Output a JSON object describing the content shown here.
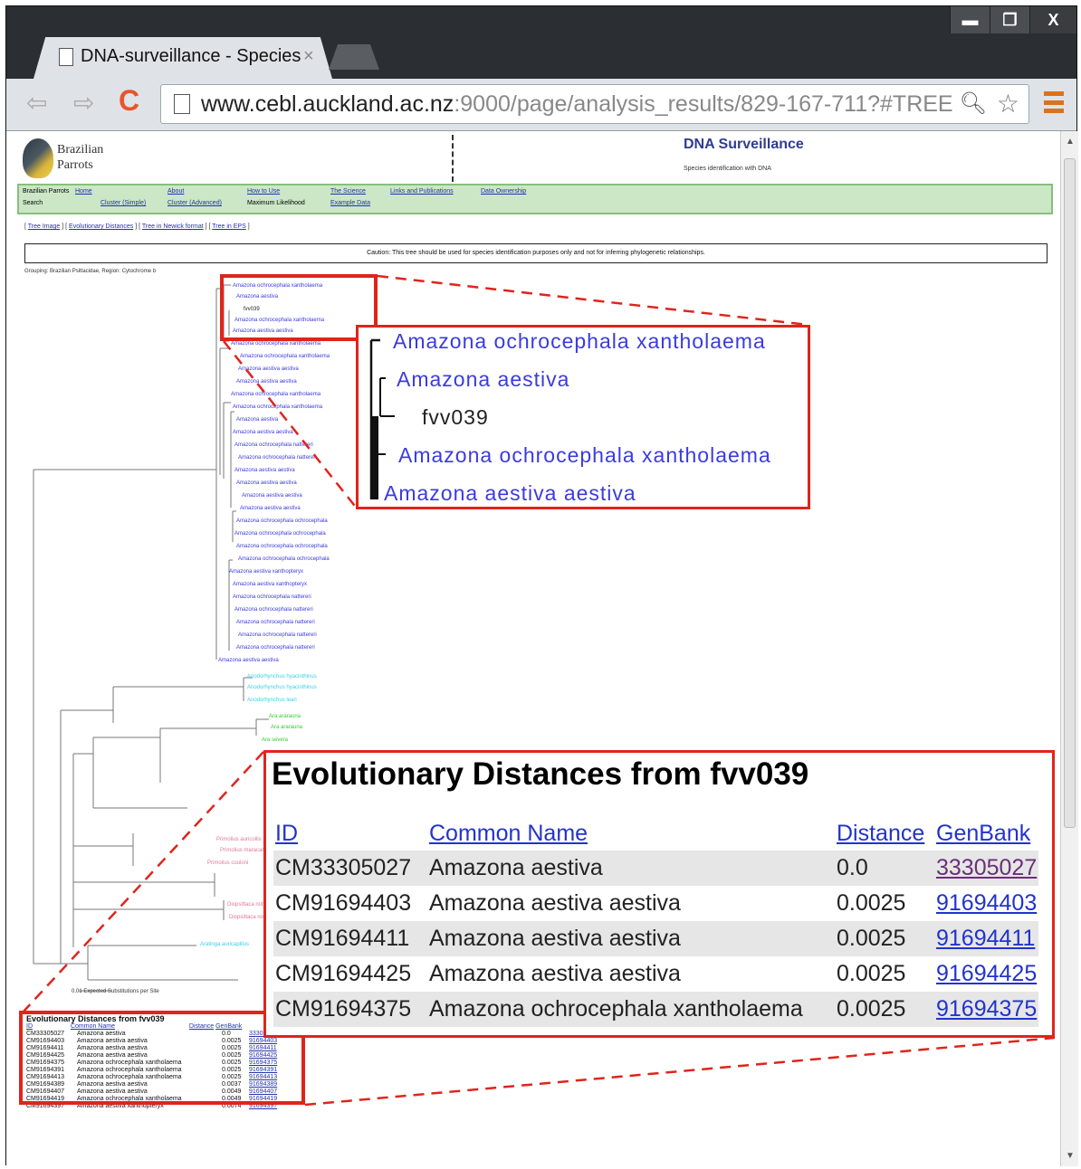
{
  "browser": {
    "tab_title": "DNA-surveillance - Species",
    "tab_close": "×",
    "url_host": "www.cebl.auckland.ac.nz",
    "url_rest": ":9000/page/analysis_results/829-167-711?#TREE",
    "window_buttons": [
      "▬",
      "❐",
      "X"
    ]
  },
  "header": {
    "logo_line1": "Brazilian",
    "logo_line2": "Parrots",
    "title": "DNA Surveillance",
    "subtitle": "Species identification with DNA"
  },
  "navbar": {
    "row1": [
      "Brazilian Parrots",
      "Home",
      "About",
      "How to Use",
      "The Science",
      "Links and Publications",
      "Data Ownership"
    ],
    "row2": [
      "Search",
      "Cluster (Simple)",
      "Cluster (Advanced)",
      "Maximum Likelihood",
      "Example Data"
    ]
  },
  "tool_links": [
    "Tree Image",
    "Evolutionary Distances",
    "Tree in Newick format",
    "Tree in EPS"
  ],
  "caution": "Caution: This tree should be used for species identification purposes only and not for inferring phylogenetic relationships.",
  "grouping": "Grouping: Brazilian Psittacidae, Region: Cytochrome b",
  "scale_label": "0.01 Expected Substitutions per Site",
  "tree_leaves": [
    "Amazona ochrocephala xantholaema",
    "Amazona aestiva",
    "fvv039",
    "Amazona ochrocephala xantholaema",
    "Amazona aestiva aestiva",
    "Amazona ochrocephala xantholaema",
    "Amazona ochrocephala xantholaema",
    "Amazona aestiva aestiva",
    "Amazona aestiva aestiva",
    "Amazona ochrocephala xantholaema",
    "Amazona ochrocephala xantholaema",
    "Amazona aestiva",
    "Amazona aestiva aestiva",
    "Amazona ochrocephala nattereri",
    "Amazona ochrocephala nattereri",
    "Amazona aestiva aestiva",
    "Amazona aestiva aestiva",
    "Amazona aestiva aestiva",
    "Amazona aestiva aestiva",
    "Amazona ochrocephala ochrocephala",
    "Amazona ochrocephala ochrocephala",
    "Amazona ochrocephala ochrocephala",
    "Amazona ochrocephala ochrocephala",
    "Amazona aestiva xanthopteryx",
    "Amazona aestiva xanthopteryx",
    "Amazona ochrocephala nattereri",
    "Amazona ochrocephala nattereri",
    "Amazona ochrocephala nattereri",
    "Amazona ochrocephala nattereri",
    "Amazona ochrocephala nattereri",
    "Amazona aestiva aestiva"
  ],
  "tree_zoom": {
    "leaves": [
      "Amazona ochrocephala xantholaema",
      "Amazona aestiva",
      "fvv039",
      "Amazona ochrocephala xantholaema",
      "Amazona aestiva aestiva"
    ]
  },
  "evolutionary": {
    "title": "Evolutionary Distances from fvv039",
    "headers": [
      "ID",
      "Common Name",
      "Distance",
      "GenBank"
    ],
    "rows": [
      [
        "CM33305027",
        "Amazona aestiva",
        "0.0",
        "33305027"
      ],
      [
        "CM91694403",
        "Amazona aestiva aestiva",
        "0.0025",
        "91694403"
      ],
      [
        "CM91694411",
        "Amazona aestiva aestiva",
        "0.0025",
        "91694411"
      ],
      [
        "CM91694425",
        "Amazona aestiva aestiva",
        "0.0025",
        "91694425"
      ],
      [
        "CM91694375",
        "Amazona ochrocephala xantholaema",
        "0.0025",
        "91694375"
      ]
    ]
  },
  "mini_table": {
    "title": "Evolutionary Distances from fvv039",
    "headers": [
      "ID",
      "Common Name",
      "Distance",
      "GenBank"
    ],
    "rows": [
      [
        "CM33305027",
        "Amazona aestiva",
        "0.0",
        "33305027"
      ],
      [
        "CM91694403",
        "Amazona aestiva aestiva",
        "0.0025",
        "91694403"
      ],
      [
        "CM91694411",
        "Amazona aestiva aestiva",
        "0.0025",
        "91694411"
      ],
      [
        "CM91694425",
        "Amazona aestiva aestiva",
        "0.0025",
        "91694425"
      ],
      [
        "CM91694375",
        "Amazona ochrocephala xantholaema",
        "0.0025",
        "91694375"
      ],
      [
        "CM91694391",
        "Amazona ochrocephala xantholaema",
        "0.0025",
        "91694391"
      ],
      [
        "CM91694413",
        "Amazona ochrocephala xantholaema",
        "0.0025",
        "91694413"
      ],
      [
        "CM91694389",
        "Amazona aestiva aestiva",
        "0.0037",
        "91694389"
      ],
      [
        "CM91694407",
        "Amazona aestiva aestiva",
        "0.0049",
        "91694407"
      ],
      [
        "CM91694419",
        "Amazona ochrocephala xantholaema",
        "0.0049",
        "91694419"
      ],
      [
        "CM91694397",
        "Amazona aestiva xanthopteryx",
        "0.0074",
        "91694397"
      ]
    ]
  },
  "colors": {
    "highlight": "#e0241c",
    "amazona": "#3b3be0",
    "cyan_clade": "#39d0e8",
    "green_clade": "#33cc33",
    "pink_clade": "#e07a9a"
  }
}
